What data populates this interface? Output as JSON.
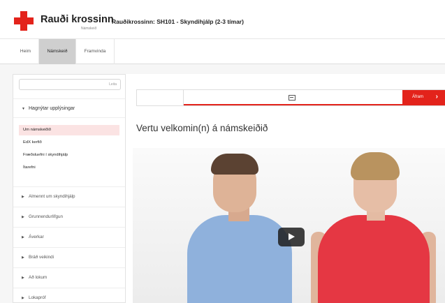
{
  "header": {
    "brand_name": "Rauði krossinn",
    "brand_sub": "Námskeið",
    "course_title": "Rauðikrossinn: SH101 - Skyndihjálp (2-3 tímar)"
  },
  "nav": {
    "tabs": [
      {
        "label": "Heim"
      },
      {
        "label": "Námskeið"
      },
      {
        "label": "Framvinda"
      }
    ]
  },
  "sidebar": {
    "search_button": "Leita",
    "open_section": "Hagnýtar upplýsingar",
    "open_items": [
      {
        "label": "Um námskeiðið"
      },
      {
        "label": "EdX kerfið"
      },
      {
        "label": "Fræðsluefni í skyndihjálp"
      },
      {
        "label": "Ítarefni"
      }
    ],
    "sections": [
      {
        "label": "Almennt um skyndihjálp"
      },
      {
        "label": "Grunnendurlífgun"
      },
      {
        "label": "Áverkar"
      },
      {
        "label": "Bráð veikindi"
      },
      {
        "label": "Að lokum"
      },
      {
        "label": "Lokapróf"
      }
    ]
  },
  "main": {
    "next_label": "Áfram",
    "welcome": "Vertu velkomin(n) á námskeiðið"
  },
  "colors": {
    "brand_red": "#e3231b",
    "active_item_bg": "#fbe3e3",
    "active_tab_bg": "#cfcfcf"
  },
  "icons": {
    "logo": "red-cross-icon",
    "seq_unit": "video-icon",
    "next": "chevron-right-icon",
    "section_collapsed": "triangle-right-icon",
    "section_expanded": "triangle-down-icon",
    "video_play": "play-icon"
  }
}
